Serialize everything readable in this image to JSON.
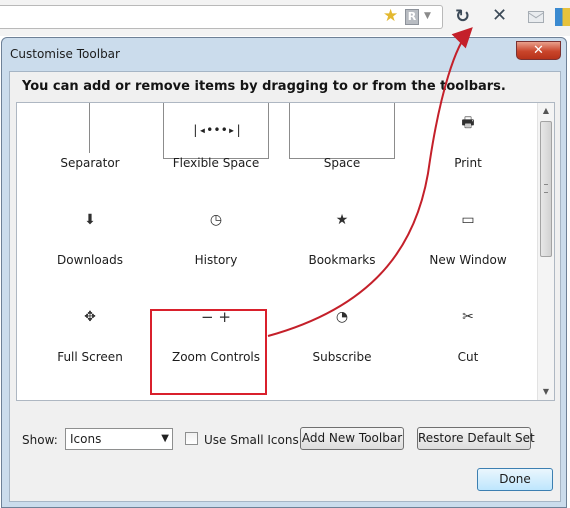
{
  "browser": {
    "icons": [
      "star-icon",
      "r-icon",
      "dropdown-arrow-icon",
      "reload-icon",
      "stop-icon",
      "mail-icon",
      "addon-icon"
    ],
    "star_glyph": "★",
    "r_glyph": "R",
    "dropdown_glyph": "▼",
    "reload_glyph": "↻",
    "stop_glyph": "✕"
  },
  "dialog": {
    "title": "Customise Toolbar",
    "close_glyph": "✕",
    "instructions": "You can add or remove items by dragging to or from the toolbars.",
    "items": [
      {
        "label": "Separator",
        "icon": "separator-icon",
        "glyph": ""
      },
      {
        "label": "Flexible Space",
        "icon": "flexible-space-icon",
        "glyph": "|◂•••▸|"
      },
      {
        "label": "Space",
        "icon": "space-icon",
        "glyph": ""
      },
      {
        "label": "Print",
        "icon": "print-icon",
        "glyph": "🖶"
      },
      {
        "label": "Downloads",
        "icon": "downloads-icon",
        "glyph": "⬇"
      },
      {
        "label": "History",
        "icon": "history-icon",
        "glyph": "◷"
      },
      {
        "label": "Bookmarks",
        "icon": "bookmarks-icon",
        "glyph": "★"
      },
      {
        "label": "New Window",
        "icon": "new-window-icon",
        "glyph": "▭"
      },
      {
        "label": "Full Screen",
        "icon": "full-screen-icon",
        "glyph": "✥"
      },
      {
        "label": "Zoom Controls",
        "icon": "zoom-controls-icon",
        "glyph": "− +"
      },
      {
        "label": "Subscribe",
        "icon": "rss-icon",
        "glyph": "◔"
      },
      {
        "label": "Cut",
        "icon": "scissors-icon",
        "glyph": "✂"
      }
    ],
    "show_label": "Show:",
    "show_value": "Icons",
    "small_icons_label": "Use Small Icons",
    "small_icons_checked": false,
    "add_toolbar_label": "Add New Toolbar",
    "restore_label": "Restore Default Set",
    "done_label": "Done"
  },
  "annotation": {
    "highlight_color": "#d9202c",
    "arrow_color": "#c4202a"
  }
}
